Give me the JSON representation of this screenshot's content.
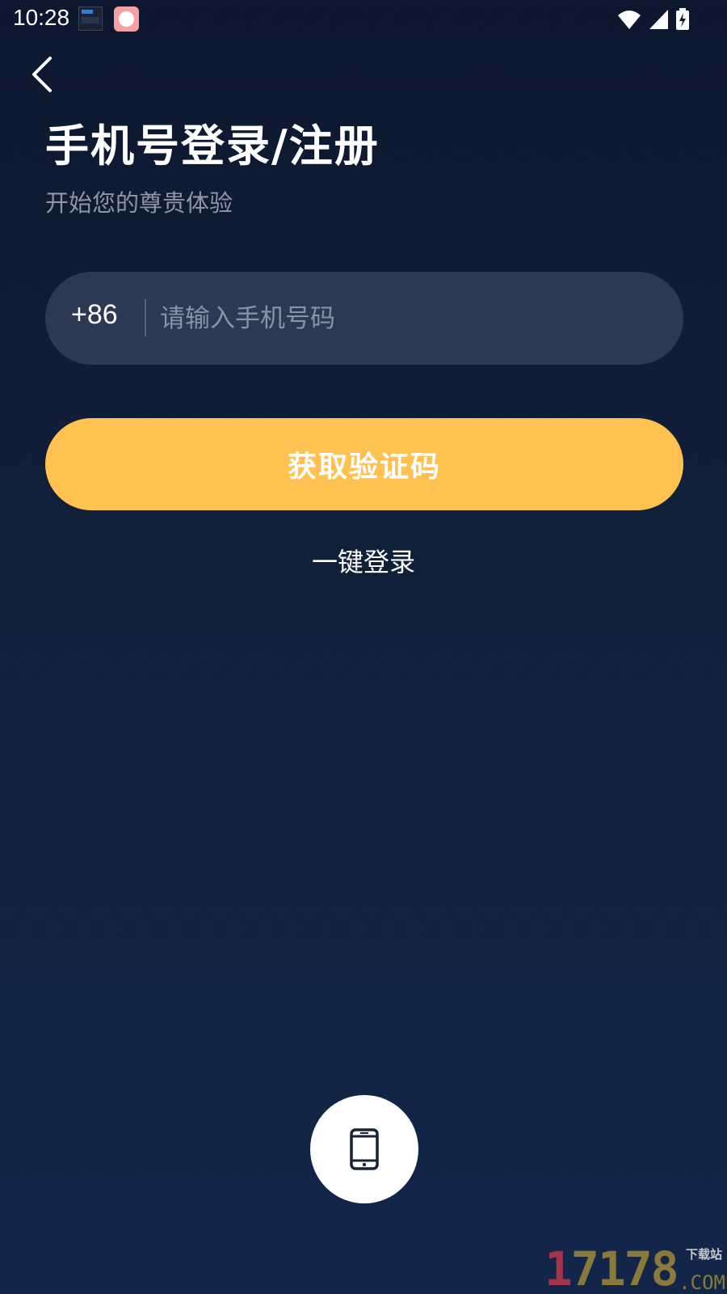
{
  "status_bar": {
    "time": "10:28",
    "notification_icons": [
      "clock-widget-icon",
      "app-notification-icon"
    ],
    "system_icons": [
      "wifi-icon",
      "cellular-signal-icon",
      "battery-charging-icon"
    ]
  },
  "header": {
    "back_icon": "chevron-left-icon",
    "title": "手机号登录/注册",
    "subtitle": "开始您的尊贵体验"
  },
  "phone_field": {
    "country_code": "+86",
    "value": "",
    "placeholder": "请输入手机号码"
  },
  "actions": {
    "get_code_label": "获取验证码",
    "one_key_login_label": "一键登录",
    "phone_login_icon": "mobile-phone-icon"
  },
  "watermark": {
    "digits_red": "1",
    "digits_gold": "7178",
    "sub": "下载站",
    "suffix": ".COM"
  },
  "colors": {
    "background_top": "#0d1830",
    "background_bottom": "#13264a",
    "input_bg": "#2b3a52",
    "accent": "#ffc251",
    "subtitle": "#8d96a8"
  }
}
